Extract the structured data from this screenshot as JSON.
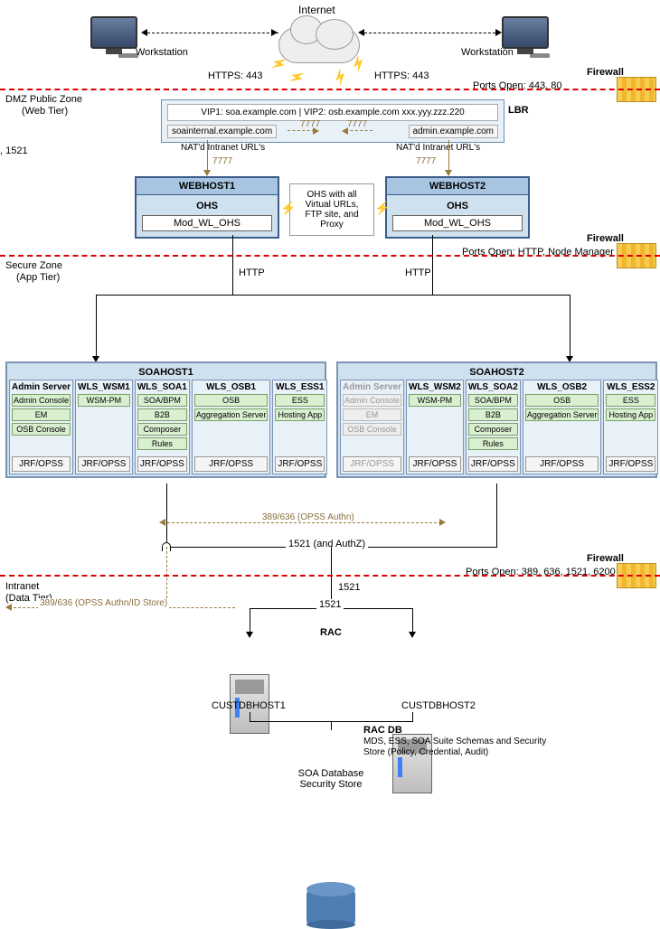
{
  "internet": {
    "label": "Internet"
  },
  "workstation": {
    "label": "Workstation"
  },
  "https": {
    "left": "HTTPS: 443",
    "right": "HTTPS: 443"
  },
  "firewall_label": "Firewall",
  "fw1": {
    "zone_main": "DMZ Public Zone",
    "zone_sub": "(Web Tier)",
    "ports": "Ports Open: 443, 80"
  },
  "fw2": {
    "zone_main": "Secure Zone",
    "zone_sub": "(App Tier)",
    "ports": "Ports Open: HTTP, Node Manager"
  },
  "fw3": {
    "zone_main": "Intranet",
    "zone_sub": "(Data Tier)",
    "ports": "Ports Open:  389, 636, 1521, 6200"
  },
  "left_port_fragment": ", 1521",
  "lbr": {
    "vip_line": "VIP1: soa.example.com | VIP2: osb.example.com  xxx.yyy.zzz.220",
    "lbr_label": "LBR",
    "left_url": "soainternal.example.com",
    "right_url": "admin.example.com",
    "nat_left": "NAT'd Intranet URL's",
    "nat_right": "NAT'd Intranet URL's",
    "port_7777": "7777"
  },
  "webhost1": {
    "title": "WEBHOST1",
    "ohs": "OHS",
    "mod": "Mod_WL_OHS"
  },
  "webhost2": {
    "title": "WEBHOST2",
    "ohs": "OHS",
    "mod": "Mod_WL_OHS"
  },
  "ohs_desc": "OHS with all Virtual URLs, FTP site, and Proxy",
  "http_label": "HTTP",
  "soahost1": {
    "title": "SOAHOST1",
    "slots": [
      {
        "head": "Admin Server",
        "pills": [
          "Admin Console",
          "EM",
          "OSB Console"
        ],
        "jrf": "JRF/OPSS",
        "inactive": false
      },
      {
        "head": "WLS_WSM1",
        "pills": [
          "WSM-PM"
        ],
        "jrf": "JRF/OPSS",
        "inactive": false
      },
      {
        "head": "WLS_SOA1",
        "pills": [
          "SOA/BPM",
          "B2B",
          "Composer",
          "Rules"
        ],
        "jrf": "JRF/OPSS",
        "inactive": false
      },
      {
        "head": "WLS_OSB1",
        "pills": [
          "OSB",
          "Aggregation Server"
        ],
        "jrf": "JRF/OPSS",
        "inactive": false
      },
      {
        "head": "WLS_ESS1",
        "pills": [
          "ESS",
          "Hosting App"
        ],
        "jrf": "JRF/OPSS",
        "inactive": false
      }
    ]
  },
  "soahost2": {
    "title": "SOAHOST2",
    "slots": [
      {
        "head": "Admin Server",
        "pills": [
          "Admin Console",
          "EM",
          "OSB Console"
        ],
        "jrf": "JRF/OPSS",
        "inactive": true
      },
      {
        "head": "WLS_WSM2",
        "pills": [
          "WSM-PM"
        ],
        "jrf": "JRF/OPSS",
        "inactive": false
      },
      {
        "head": "WLS_SOA2",
        "pills": [
          "SOA/BPM",
          "B2B",
          "Composer",
          "Rules"
        ],
        "jrf": "JRF/OPSS",
        "inactive": false
      },
      {
        "head": "WLS_OSB2",
        "pills": [
          "OSB",
          "Aggregation Server"
        ],
        "jrf": "JRF/OPSS",
        "inactive": false
      },
      {
        "head": "WLS_ESS2",
        "pills": [
          "ESS",
          "Hosting App"
        ],
        "jrf": "JRF/OPSS",
        "inactive": false
      }
    ]
  },
  "opss_authn": "389/636 (OPSS Authn)",
  "authz_line": "1521 (and AuthZ)",
  "opss_id_store": "389/636 (OPSS Authn/ID Store)",
  "port_1521": "1521",
  "rac": {
    "label": "RAC",
    "host1": "CUSTDBHOST1",
    "host2": "CUSTDBHOST2",
    "db_title": "RAC DB",
    "db_desc": "MDS, ESS, SOA Suite Schemas and Security Store (Policy, Credential, Audit)",
    "db_footer1": "SOA Database",
    "db_footer2": "Security Store"
  }
}
